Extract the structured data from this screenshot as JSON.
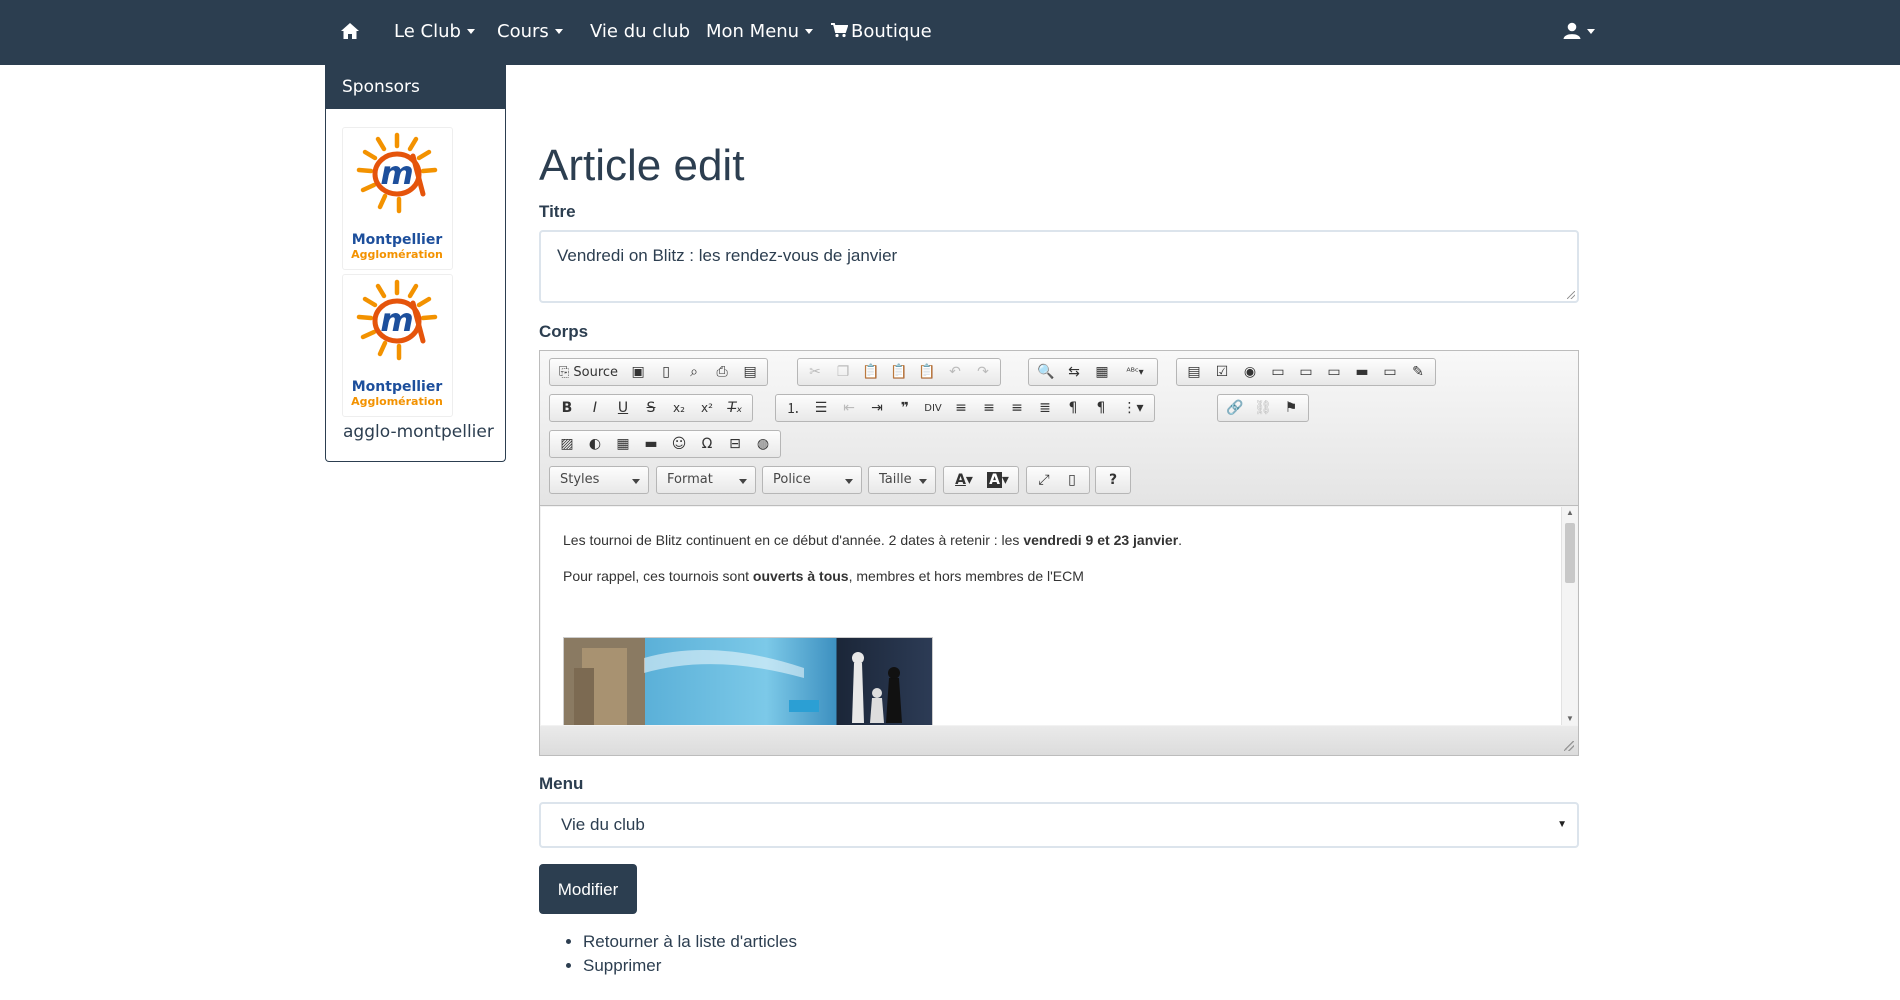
{
  "nav": {
    "items": [
      {
        "label": "Le Club",
        "dropdown": true
      },
      {
        "label": "Cours",
        "dropdown": true
      },
      {
        "label": "Vie du club",
        "dropdown": false
      },
      {
        "label": "Mon Menu",
        "dropdown": true
      },
      {
        "label": "Boutique",
        "dropdown": false
      }
    ]
  },
  "sidebar": {
    "title": "Sponsors",
    "sponsor_logo_text": [
      "Montpellier",
      "Agglomération"
    ],
    "sponsor_name": "agglo-montpellier"
  },
  "page": {
    "title": "Article edit"
  },
  "form": {
    "titre_label": "Titre",
    "titre_value": "Vendredi on Blitz : les rendez-vous de janvier",
    "corps_label": "Corps",
    "menu_label": "Menu",
    "menu_selected": "Vie du club",
    "submit_label": "Modifier"
  },
  "editor": {
    "source_label": "Source",
    "combos": [
      "Styles",
      "Format",
      "Police",
      "Taille"
    ],
    "paragraph1": {
      "before": "Les tournoi de Blitz continuent en ce début d'année. 2 dates à retenir : les ",
      "bold": "vendredi 9 et 23 janvier",
      "after": "."
    },
    "paragraph2": {
      "before": "Pour rappel, ces tournois sont ",
      "bold": "ouverts à tous",
      "after": ", membres et hors membres de l'ECM"
    }
  },
  "links": [
    {
      "label": "Retourner à la liste d'articles"
    },
    {
      "label": "Supprimer"
    }
  ],
  "colors": {
    "navbar": "#2c3e50",
    "sponsor_orange": "#f39200",
    "sponsor_blue": "#1d4f9c"
  }
}
